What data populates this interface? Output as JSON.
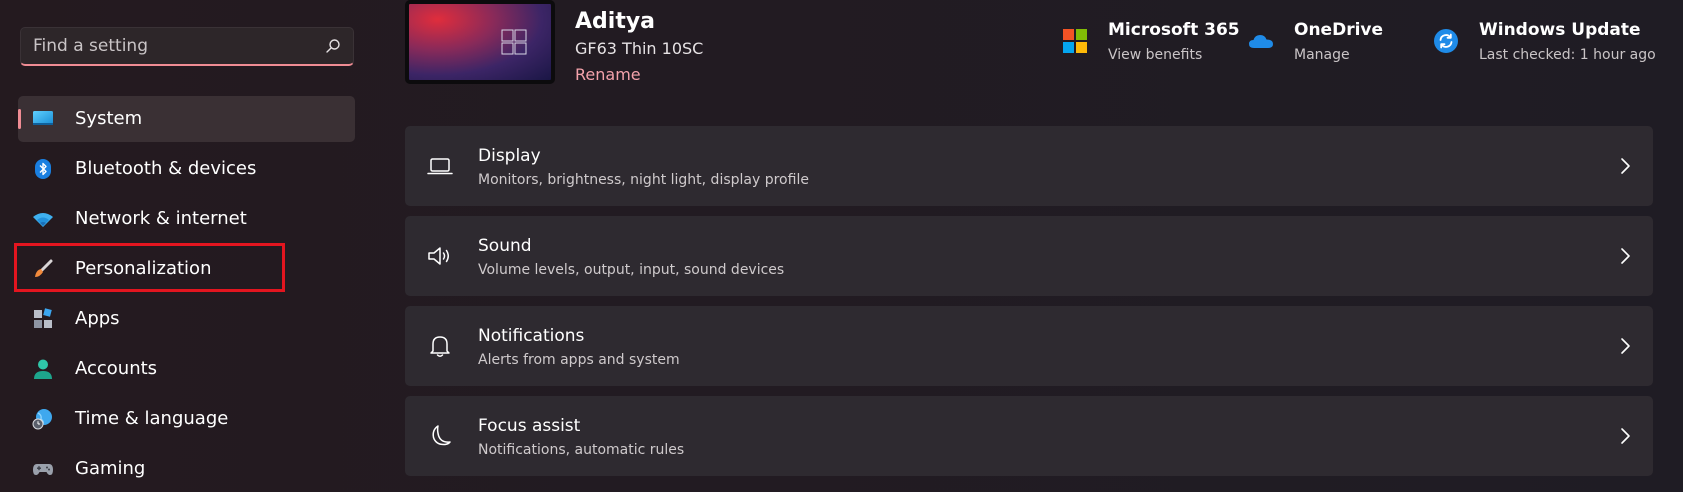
{
  "search": {
    "placeholder": "Find a setting"
  },
  "sidebar": {
    "items": [
      {
        "label": "System",
        "icon": "monitor-icon",
        "selected": true
      },
      {
        "label": "Bluetooth & devices",
        "icon": "bluetooth-icon"
      },
      {
        "label": "Network & internet",
        "icon": "wifi-icon"
      },
      {
        "label": "Personalization",
        "icon": "paintbrush-icon",
        "highlighted": true
      },
      {
        "label": "Apps",
        "icon": "apps-icon"
      },
      {
        "label": "Accounts",
        "icon": "person-icon"
      },
      {
        "label": "Time & language",
        "icon": "globe-clock-icon"
      },
      {
        "label": "Gaming",
        "icon": "gamepad-icon"
      }
    ]
  },
  "device": {
    "name": "Aditya",
    "model": "GF63 Thin 10SC",
    "rename_label": "Rename"
  },
  "quick_links": [
    {
      "title": "Microsoft 365",
      "subtitle": "View benefits",
      "icon": "microsoft-logo-icon"
    },
    {
      "title": "OneDrive",
      "subtitle": "Manage",
      "icon": "cloud-icon"
    },
    {
      "title": "Windows Update",
      "subtitle": "Last checked: 1 hour ago",
      "icon": "sync-icon"
    }
  ],
  "settings": [
    {
      "title": "Display",
      "subtitle": "Monitors, brightness, night light, display profile",
      "icon": "laptop-icon"
    },
    {
      "title": "Sound",
      "subtitle": "Volume levels, output, input, sound devices",
      "icon": "speaker-icon"
    },
    {
      "title": "Notifications",
      "subtitle": "Alerts from apps and system",
      "icon": "bell-icon"
    },
    {
      "title": "Focus assist",
      "subtitle": "Notifications, automatic rules",
      "icon": "moon-icon"
    }
  ],
  "colors": {
    "accent": "#f08c94",
    "highlight_border": "#e3151f",
    "card_bg": "#2e2a30",
    "link": "#f4a2ab"
  }
}
